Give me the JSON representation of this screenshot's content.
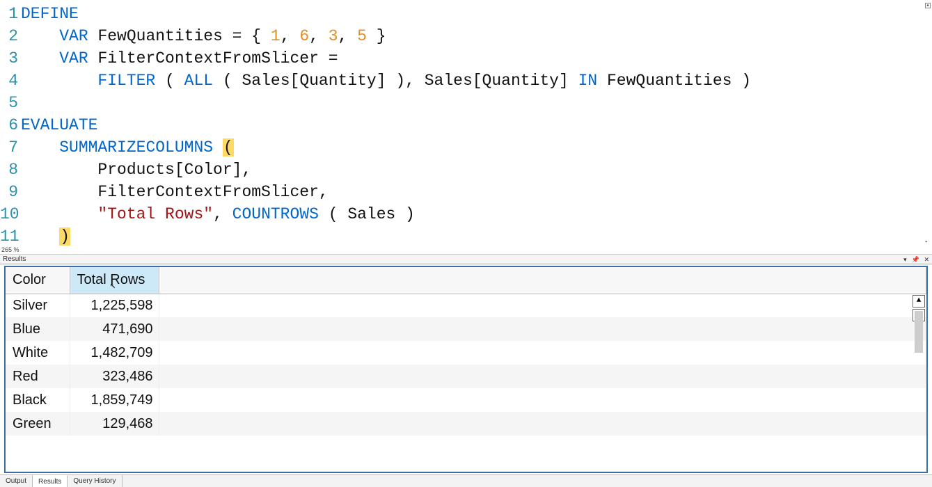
{
  "editor": {
    "zoom": "265 %",
    "lines": [
      {
        "n": 1,
        "tokens": [
          {
            "t": "DEFINE",
            "c": "kw"
          }
        ]
      },
      {
        "n": 2,
        "tokens": [
          {
            "t": "    ",
            "c": "id"
          },
          {
            "t": "VAR",
            "c": "kw"
          },
          {
            "t": " FewQuantities = { ",
            "c": "id"
          },
          {
            "t": "1",
            "c": "num"
          },
          {
            "t": ", ",
            "c": "id"
          },
          {
            "t": "6",
            "c": "num"
          },
          {
            "t": ", ",
            "c": "id"
          },
          {
            "t": "3",
            "c": "num"
          },
          {
            "t": ", ",
            "c": "id"
          },
          {
            "t": "5",
            "c": "num"
          },
          {
            "t": " }",
            "c": "id"
          }
        ]
      },
      {
        "n": 3,
        "tokens": [
          {
            "t": "    ",
            "c": "id"
          },
          {
            "t": "VAR",
            "c": "kw"
          },
          {
            "t": " FilterContextFromSlicer =",
            "c": "id"
          }
        ]
      },
      {
        "n": 4,
        "tokens": [
          {
            "t": "        ",
            "c": "id"
          },
          {
            "t": "FILTER",
            "c": "kw"
          },
          {
            "t": " ( ",
            "c": "id"
          },
          {
            "t": "ALL",
            "c": "kw"
          },
          {
            "t": " ( Sales[Quantity] ), Sales[Quantity] ",
            "c": "id"
          },
          {
            "t": "IN",
            "c": "kw"
          },
          {
            "t": " FewQuantities )",
            "c": "id"
          }
        ]
      },
      {
        "n": 5,
        "tokens": []
      },
      {
        "n": 6,
        "tokens": [
          {
            "t": "EVALUATE",
            "c": "kw"
          }
        ]
      },
      {
        "n": 7,
        "tokens": [
          {
            "t": "    ",
            "c": "id"
          },
          {
            "t": "SUMMARIZECOLUMNS",
            "c": "kw"
          },
          {
            "t": " ",
            "c": "id"
          },
          {
            "t": "(",
            "c": "id",
            "hl": true
          }
        ]
      },
      {
        "n": 8,
        "tokens": [
          {
            "t": "        Products[Color],",
            "c": "id"
          }
        ]
      },
      {
        "n": 9,
        "tokens": [
          {
            "t": "        FilterContextFromSlicer,",
            "c": "id"
          }
        ]
      },
      {
        "n": 10,
        "tokens": [
          {
            "t": "        ",
            "c": "id"
          },
          {
            "t": "\"Total Rows\"",
            "c": "str"
          },
          {
            "t": ", ",
            "c": "id"
          },
          {
            "t": "COUNTROWS",
            "c": "kw"
          },
          {
            "t": " ( Sales )",
            "c": "id"
          }
        ]
      },
      {
        "n": 11,
        "tokens": [
          {
            "t": "    ",
            "c": "id"
          },
          {
            "t": ")",
            "c": "id",
            "hl": true
          }
        ]
      }
    ]
  },
  "results": {
    "pane_title": "Results",
    "controls": {
      "dropdown": "▾",
      "pin": "📌",
      "close": "✕"
    },
    "columns": [
      "Color",
      "Total Rows"
    ],
    "sorted_col": 1,
    "rows": [
      {
        "color": "Silver",
        "total": "1,225,598"
      },
      {
        "color": "Blue",
        "total": "471,690"
      },
      {
        "color": "White",
        "total": "1,482,709"
      },
      {
        "color": "Red",
        "total": "323,486"
      },
      {
        "color": "Black",
        "total": "1,859,749"
      },
      {
        "color": "Green",
        "total": "129,468"
      }
    ],
    "scroll": {
      "up": "▲",
      "down": "▼"
    }
  },
  "tabs": {
    "items": [
      "Output",
      "Results",
      "Query History"
    ],
    "active": 1
  }
}
